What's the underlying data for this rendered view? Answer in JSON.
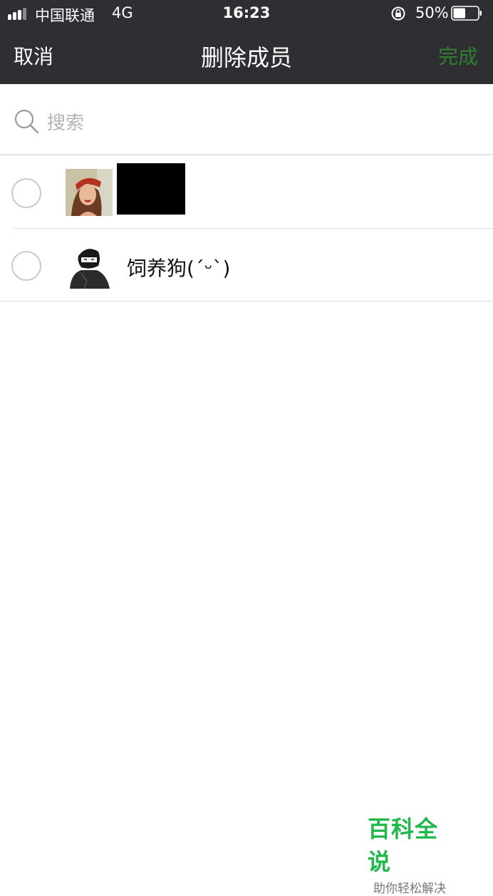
{
  "status_bar": {
    "carrier": "中国联通",
    "network": "4G",
    "time": "16:23",
    "battery_percent": "50%",
    "battery_level": 0.5
  },
  "nav": {
    "cancel_label": "取消",
    "title": "删除成员",
    "done_label": "完成"
  },
  "search": {
    "placeholder": "搜索",
    "icon": "search-icon"
  },
  "members": [
    {
      "name": "",
      "selected": false,
      "name_redacted": true
    },
    {
      "name": "饲养狗(ˊᵕˋ)",
      "selected": false,
      "name_redacted": false
    }
  ],
  "watermark": {
    "title": "百科全说",
    "subtitle": "助你轻松解决"
  },
  "colors": {
    "nav_background": "#2e2e33",
    "done_text": "#2f7f2f",
    "watermark_green": "#1fb84a"
  }
}
